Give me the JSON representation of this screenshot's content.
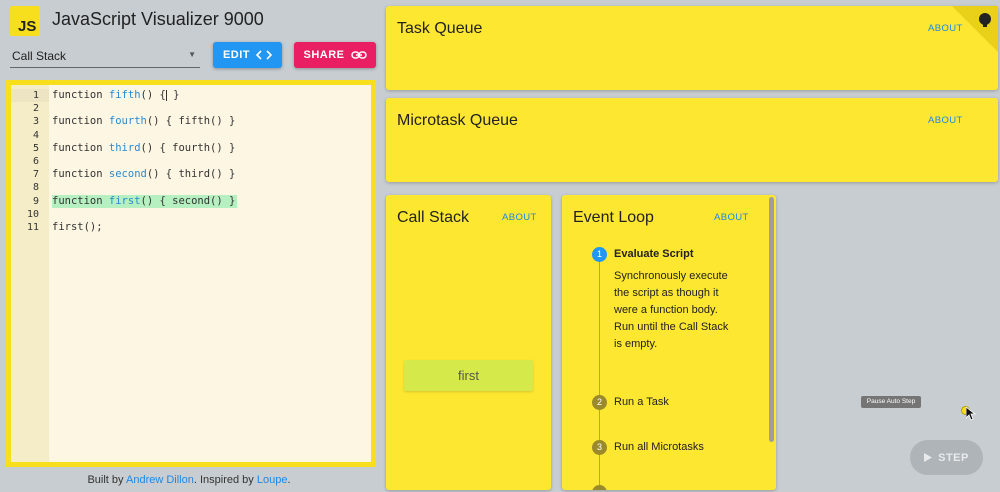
{
  "app": {
    "logo_text": "JS",
    "title": "JavaScript Visualizer 9000"
  },
  "controls": {
    "example_select": {
      "value": "Call Stack"
    },
    "edit_label": "EDIT",
    "share_label": "SHARE"
  },
  "editor": {
    "active_line": 1,
    "highlighted_line": 9,
    "lines": [
      {
        "n": "1",
        "pre": "function ",
        "fn": "fifth",
        "post": "() {",
        "tail": " }"
      },
      {
        "n": "2",
        "pre": "",
        "fn": "",
        "post": "",
        "tail": ""
      },
      {
        "n": "3",
        "pre": "function ",
        "fn": "fourth",
        "post": "() { fifth() }",
        "tail": ""
      },
      {
        "n": "4",
        "pre": "",
        "fn": "",
        "post": "",
        "tail": ""
      },
      {
        "n": "5",
        "pre": "function ",
        "fn": "third",
        "post": "() { fourth() }",
        "tail": ""
      },
      {
        "n": "6",
        "pre": "",
        "fn": "",
        "post": "",
        "tail": ""
      },
      {
        "n": "7",
        "pre": "function ",
        "fn": "second",
        "post": "() { third() }",
        "tail": ""
      },
      {
        "n": "8",
        "pre": "",
        "fn": "",
        "post": "",
        "tail": ""
      },
      {
        "n": "9",
        "pre": "function ",
        "fn": "first",
        "post": "() { second() }",
        "tail": ""
      },
      {
        "n": "10",
        "pre": "",
        "fn": "",
        "post": "",
        "tail": ""
      },
      {
        "n": "11",
        "pre": "first();",
        "fn": "",
        "post": "",
        "tail": ""
      }
    ]
  },
  "footer": {
    "built_by": "Built by ",
    "author": "Andrew Dillon",
    "inspired_by": ". Inspired by ",
    "inspiration": "Loupe",
    "end": "."
  },
  "panels": {
    "task_queue": {
      "title": "Task Queue",
      "about": "ABOUT"
    },
    "microtask_queue": {
      "title": "Microtask Queue",
      "about": "ABOUT"
    },
    "call_stack": {
      "title": "Call Stack",
      "about": "ABOUT",
      "frames": [
        "first"
      ]
    },
    "event_loop": {
      "title": "Event Loop",
      "about": "ABOUT",
      "steps": [
        {
          "num": "1",
          "label": "Evaluate Script",
          "active": true
        },
        {
          "num": "2",
          "label": "Run a Task",
          "active": false
        },
        {
          "num": "3",
          "label": "Run all Microtasks",
          "active": false
        }
      ],
      "active_description": "Synchronously execute the script as though it were a function body. Run until the Call Stack is empty."
    }
  },
  "stepper": {
    "tooltip": "Pause Auto Step",
    "step_label": "STEP"
  },
  "colors": {
    "js_yellow": "#f7df1e",
    "panel_yellow": "#fde731",
    "edit_blue": "#2196f3",
    "share_pink": "#e91e63",
    "highlight_green": "#b6f0c0"
  }
}
